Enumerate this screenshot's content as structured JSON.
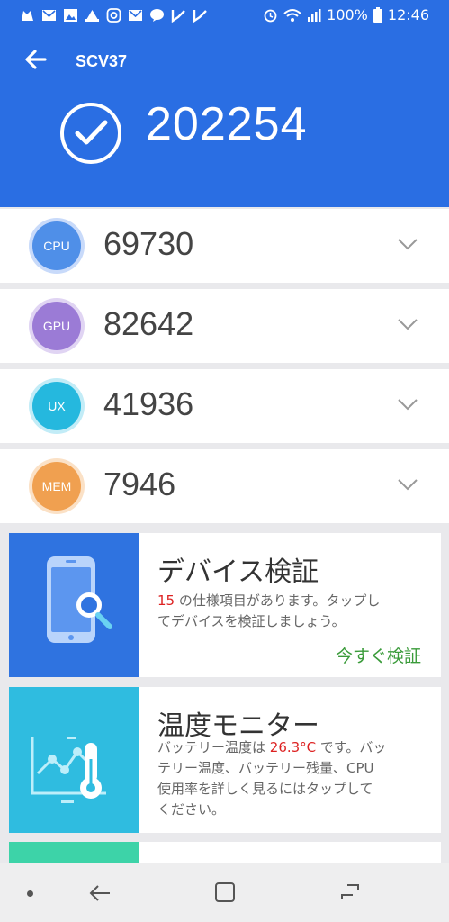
{
  "status": {
    "battery": "100%",
    "time": "12:46"
  },
  "header": {
    "device": "SCV37",
    "total_score": "202254"
  },
  "scores": [
    {
      "badge": "CPU",
      "value": "69730",
      "color": "#4f8fe8"
    },
    {
      "badge": "GPU",
      "value": "82642",
      "color": "#9b7bd6"
    },
    {
      "badge": "UX",
      "value": "41936",
      "color": "#25b8de"
    },
    {
      "badge": "MEM",
      "value": "7946",
      "color": "#f0a050"
    }
  ],
  "cards": {
    "verify": {
      "title": "デバイス検証",
      "count": "15",
      "desc_rest_1": " の仕様項目があります。タップし",
      "desc_line_2": "てデバイスを検証しましょう。",
      "action": "今すぐ検証"
    },
    "temp": {
      "title": "温度モニター",
      "desc_pre": "バッテリー温度は ",
      "temp_value": "26.3°C",
      "desc_post_1": " です。バッ",
      "desc_line_2": "テリー温度、バッテリー残量、CPU",
      "desc_line_3": "使用率を詳しく見るにはタップして",
      "desc_line_4": "ください。"
    }
  },
  "icons": [
    "app-icon",
    "mail-icon",
    "gallery-icon",
    "shopping-icon",
    "instagram-icon",
    "mail-icon",
    "line-icon",
    "check-icon",
    "check-icon",
    "alarm-icon",
    "wifi-icon",
    "signal-icon",
    "battery-icon",
    "back-arrow-icon",
    "checkmark-icon",
    "chevron-down-icon",
    "phone-search-icon",
    "thermometer-chart-icon",
    "nav-back-icon",
    "nav-home-icon",
    "nav-recent-icon"
  ]
}
